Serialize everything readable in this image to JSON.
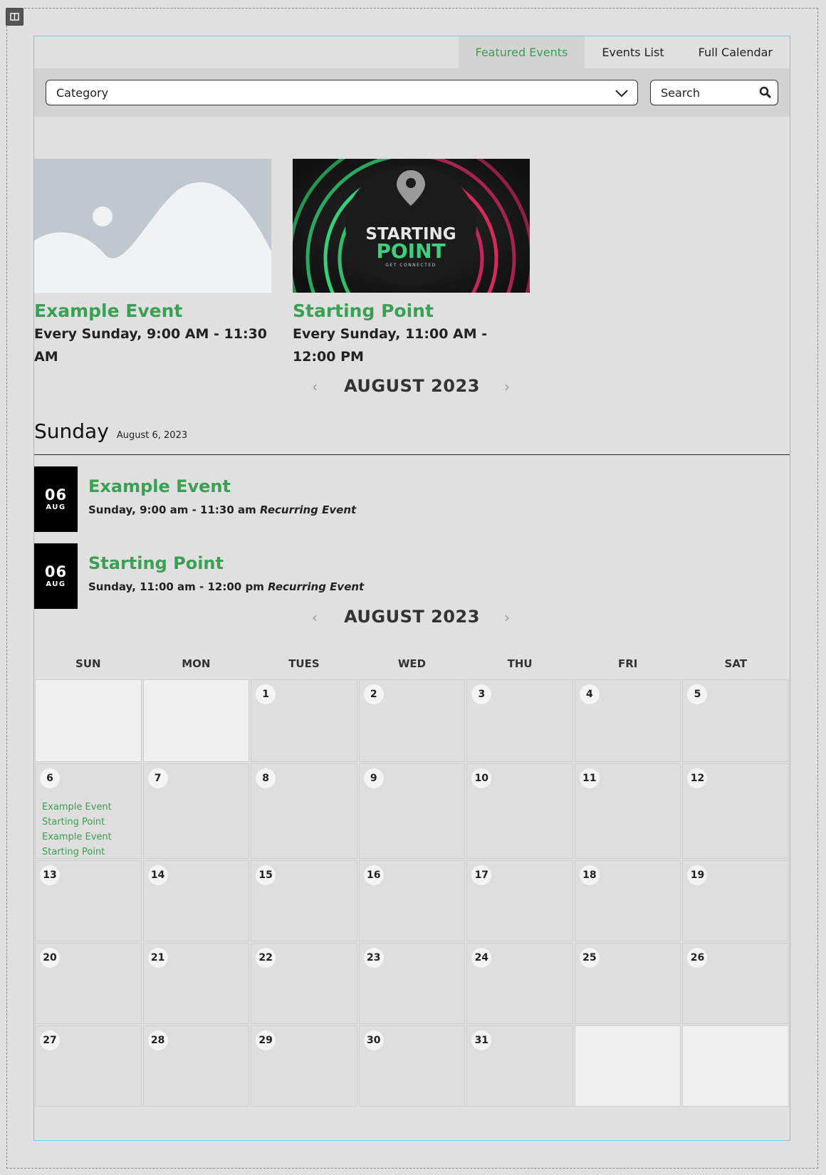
{
  "tabs": [
    {
      "label": "Featured Events",
      "active": true
    },
    {
      "label": "Events List",
      "active": false
    },
    {
      "label": "Full Calendar",
      "active": false
    }
  ],
  "filter": {
    "category_value": "Category",
    "search_placeholder": "Search"
  },
  "featured": [
    {
      "title": "Example Event",
      "schedule": "Every Sunday, 9:00 AM - 11:30 AM",
      "image": "placeholder-image"
    },
    {
      "title": "Starting Point",
      "schedule": "Every Sunday, 11:00 AM - 12:00 PM",
      "image": "starting-point-graphic",
      "image_text": {
        "line1": "STARTING",
        "line2": "POINT",
        "line3": "GET CONNECTED"
      }
    }
  ],
  "list_nav": {
    "month": "AUGUST 2023"
  },
  "day_group": {
    "day": "Sunday",
    "date": "August 6, 2023"
  },
  "list_events": [
    {
      "day": "06",
      "month": "AUG",
      "title": "Example Event",
      "time": "Sunday, 9:00 am - 11:30 am",
      "tag": "Recurring Event"
    },
    {
      "day": "06",
      "month": "AUG",
      "title": "Starting Point",
      "time": "Sunday, 11:00 am - 12:00 pm",
      "tag": "Recurring Event"
    }
  ],
  "calendar": {
    "month": "AUGUST 2023",
    "weekdays": [
      "SUN",
      "MON",
      "TUES",
      "WED",
      "THU",
      "FRI",
      "SAT"
    ],
    "weeks": [
      [
        null,
        null,
        1,
        2,
        3,
        4,
        5
      ],
      [
        6,
        7,
        8,
        9,
        10,
        11,
        12
      ],
      [
        13,
        14,
        15,
        16,
        17,
        18,
        19
      ],
      [
        20,
        21,
        22,
        23,
        24,
        25,
        26
      ],
      [
        27,
        28,
        29,
        30,
        31,
        null,
        null
      ]
    ],
    "events_on_6": [
      "Example Event",
      "Starting Point",
      "Example Event",
      "Starting Point"
    ]
  },
  "colors": {
    "accent": "#3aa053",
    "tab_active_bg": "#d3d3d3",
    "border_blue": "#7ec5ea"
  }
}
